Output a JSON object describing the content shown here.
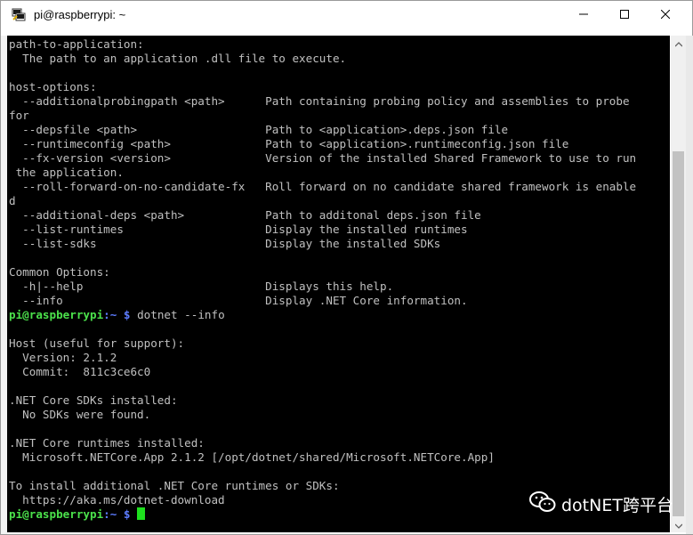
{
  "window": {
    "title": "pi@raspberrypi: ~"
  },
  "terminal": {
    "lines": [
      {
        "text": "path-to-application:"
      },
      {
        "text": "  The path to an application .dll file to execute."
      },
      {
        "text": ""
      },
      {
        "text": "host-options:"
      },
      {
        "text": "  --additionalprobingpath <path>      Path containing probing policy and assemblies to probe"
      },
      {
        "text": "for"
      },
      {
        "text": "  --depsfile <path>                   Path to <application>.deps.json file"
      },
      {
        "text": "  --runtimeconfig <path>              Path to <application>.runtimeconfig.json file"
      },
      {
        "text": "  --fx-version <version>              Version of the installed Shared Framework to use to run"
      },
      {
        "text": " the application."
      },
      {
        "text": "  --roll-forward-on-no-candidate-fx   Roll forward on no candidate shared framework is enable"
      },
      {
        "text": "d"
      },
      {
        "text": "  --additional-deps <path>            Path to additonal deps.json file"
      },
      {
        "text": "  --list-runtimes                     Display the installed runtimes"
      },
      {
        "text": "  --list-sdks                         Display the installed SDKs"
      },
      {
        "text": ""
      },
      {
        "text": "Common Options:"
      },
      {
        "text": "  -h|--help                           Displays this help."
      },
      {
        "text": "  --info                              Display .NET Core information."
      },
      {
        "prompt": true,
        "user": "pi@raspberrypi",
        "path": ":~ $",
        "cmd": " dotnet --info"
      },
      {
        "text": ""
      },
      {
        "text": "Host (useful for support):"
      },
      {
        "text": "  Version: 2.1.2"
      },
      {
        "text": "  Commit:  811c3ce6c0"
      },
      {
        "text": ""
      },
      {
        "text": ".NET Core SDKs installed:"
      },
      {
        "text": "  No SDKs were found."
      },
      {
        "text": ""
      },
      {
        "text": ".NET Core runtimes installed:"
      },
      {
        "text": "  Microsoft.NETCore.App 2.1.2 [/opt/dotnet/shared/Microsoft.NETCore.App]"
      },
      {
        "text": ""
      },
      {
        "text": "To install additional .NET Core runtimes or SDKs:"
      },
      {
        "text": "  https://aka.ms/dotnet-download"
      },
      {
        "prompt": true,
        "user": "pi@raspberrypi",
        "path": ":~ $",
        "cmd": " ",
        "cursor": true
      }
    ]
  },
  "watermark": {
    "text": "dotNET跨平台"
  },
  "icons": {
    "app": "putty-icon",
    "minimize": "minimize-icon",
    "maximize": "maximize-icon",
    "close": "close-icon",
    "wechat": "wechat-icon"
  },
  "colors": {
    "terminal_bg": "#000000",
    "terminal_fg": "#c0c0c0",
    "prompt_user": "#4be14b",
    "prompt_path": "#5c7cff",
    "cursor": "#1ee01e"
  }
}
